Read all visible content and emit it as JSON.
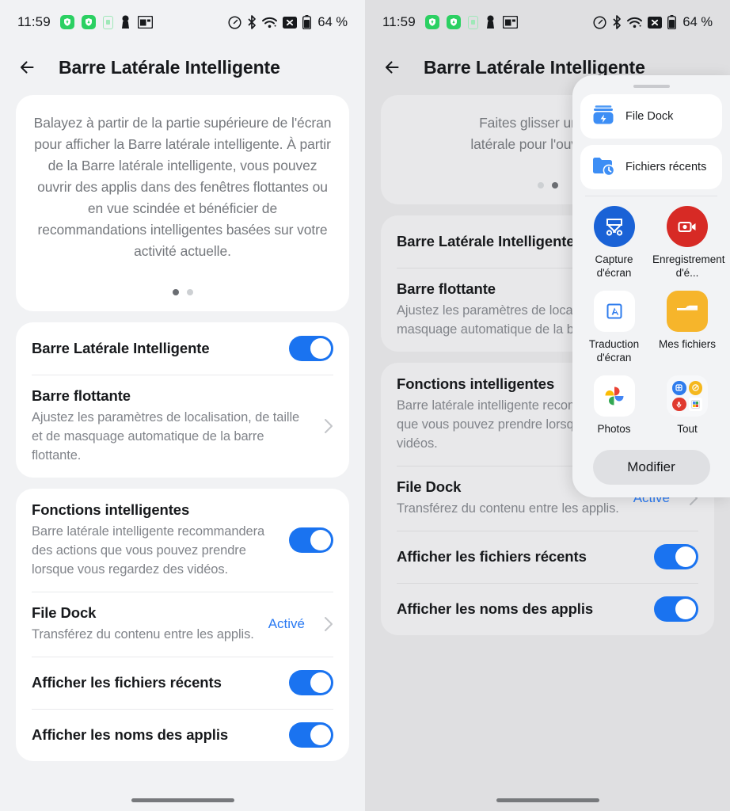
{
  "status_bar": {
    "time": "11:59",
    "battery_text": "64 %",
    "left_icons": [
      "shield-up-icon",
      "shield-down-icon",
      "battery-saver-icon",
      "vpn-key-icon",
      "window-icon"
    ],
    "right_icons": [
      "speedometer-icon",
      "bluetooth-icon",
      "wifi-icon",
      "no-sim-icon",
      "battery-icon"
    ]
  },
  "appbar": {
    "title": "Barre Latérale Intelligente",
    "back_icon": "back-arrow-icon"
  },
  "hero_left": {
    "text": "Balayez à partir de la partie supérieure de l'écran pour afficher la Barre latérale intelligente. À partir de la Barre latérale intelligente, vous pouvez ouvrir des applis dans des fenêtres flottantes ou en vue scindée et bénéficier de recommandations intelligentes basées sur votre activité actuelle.",
    "active_dot": 0,
    "dot_count": 2
  },
  "hero_right": {
    "line1": "Faites glisser une appl",
    "line2": "latérale pour l'ouvrir en m",
    "active_dot": 1,
    "dot_count": 2
  },
  "sections": {
    "main": {
      "sidebar_toggle": {
        "title": "Barre Latérale Intelligente",
        "enabled": true
      },
      "floating_bar": {
        "title": "Barre flottante",
        "subtitle": "Ajustez les paramètres de localisation, de taille et de masquage automatique de la barre flottante."
      }
    },
    "smart": {
      "smart_features": {
        "title": "Fonctions intelligentes",
        "subtitle": "Barre latérale intelligente recommandera des actions que vous pouvez prendre lorsque vous regardez des vidéos.",
        "enabled": true
      },
      "file_dock": {
        "title": "File Dock",
        "subtitle": "Transférez du contenu entre les applis.",
        "value": "Activé"
      },
      "show_recent_files": {
        "title": "Afficher les fichiers récents",
        "enabled": true
      },
      "show_app_names": {
        "title": "Afficher les noms des applis",
        "enabled": true
      }
    }
  },
  "popup": {
    "handle": "drag-handle",
    "tiles": [
      {
        "label": "File Dock",
        "icon": "file-dock-icon"
      },
      {
        "label": "Fichiers récents",
        "icon": "recent-files-folder-icon"
      }
    ],
    "apps": [
      {
        "label": "Capture d'écran",
        "icon": "screenshot-icon",
        "color": "#1a62d6"
      },
      {
        "label": "Enregistrement d'é...",
        "icon": "screen-record-icon",
        "color": "#d72a25"
      },
      {
        "label": "Traduction d'écran",
        "icon": "screen-translate-icon",
        "color": "#ffffff"
      },
      {
        "label": "Mes fichiers",
        "icon": "my-files-folder-icon",
        "color": "#f6b52b"
      },
      {
        "label": "Photos",
        "icon": "google-photos-icon",
        "color": "#ffffff"
      },
      {
        "label": "Tout",
        "icon": "all-apps-grid-icon",
        "color": "#f7f8fa"
      }
    ],
    "edit_button": "Modifier"
  },
  "colors": {
    "accent_blue": "#1a73f0",
    "link_blue": "#2979f2",
    "status_green": "#2bd062"
  },
  "gesture_bar": "home-indicator"
}
